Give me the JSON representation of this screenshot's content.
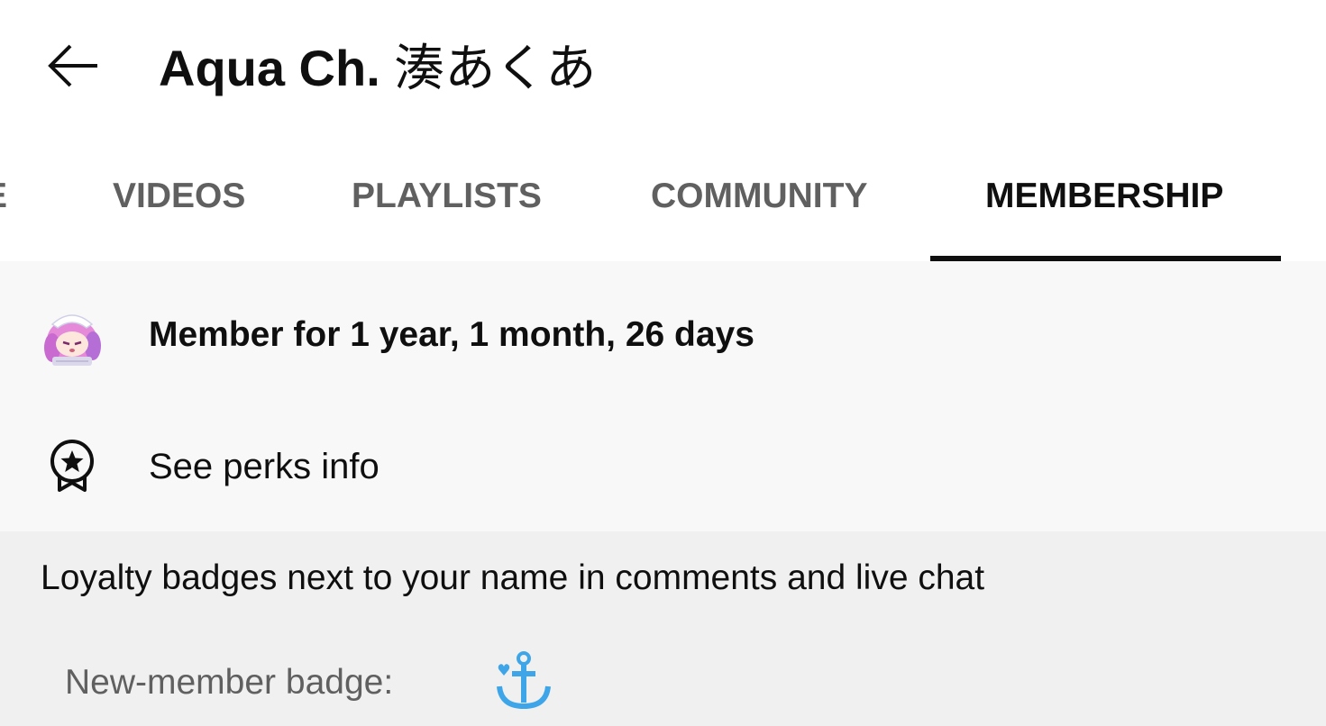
{
  "header": {
    "back_icon": "arrow-left-icon",
    "title_latin": "Aqua Ch.",
    "title_jp": "湊あくあ"
  },
  "tabs": [
    {
      "label": "E",
      "active": false
    },
    {
      "label": "VIDEOS",
      "active": false
    },
    {
      "label": "PLAYLISTS",
      "active": false
    },
    {
      "label": "COMMUNITY",
      "active": false
    },
    {
      "label": "MEMBERSHIP",
      "active": true
    }
  ],
  "membership": {
    "avatar_icon": "channel-avatar",
    "duration_text": "Member for 1 year, 1 month, 26 days",
    "perks_icon": "award-ribbon-icon",
    "perks_text": "See perks info"
  },
  "loyalty": {
    "heading": "Loyalty badges next to your name in comments and live chat",
    "new_member_label": "New-member badge:",
    "badge_icon": "anchor-badge-icon"
  },
  "colors": {
    "text_primary": "#0f0f0f",
    "text_secondary": "#606060",
    "section_bg": "#f8f8f8",
    "loyalty_bg": "#f0f0f0",
    "badge_blue": "#3ea6e8"
  }
}
